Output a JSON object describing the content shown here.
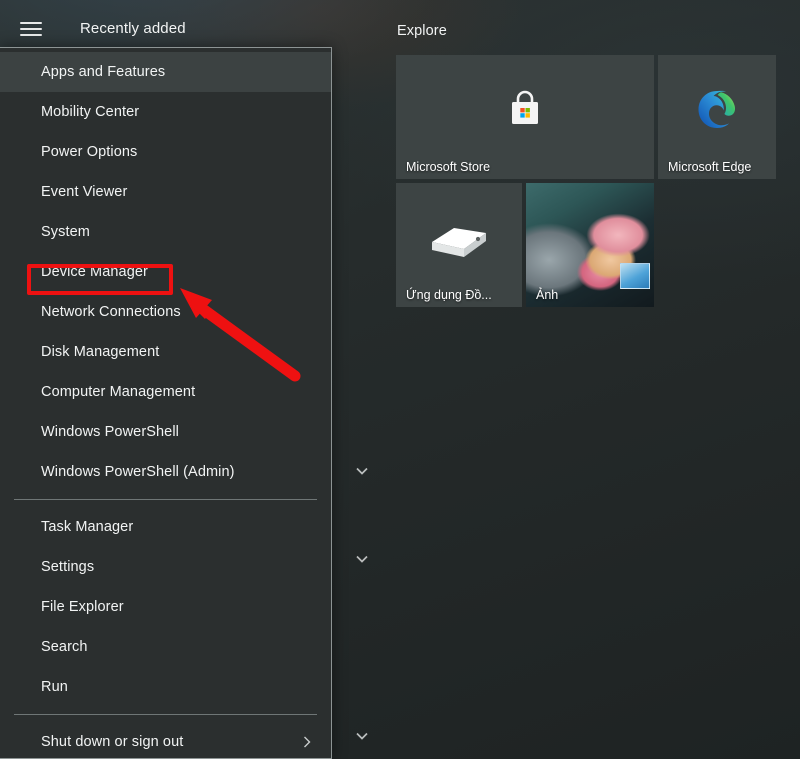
{
  "header": {
    "hamburger_icon": "hamburger-menu-icon",
    "recently_added_label": "Recently added",
    "explore_label": "Explore"
  },
  "tiles": [
    {
      "label": "Microsoft Store",
      "icon": "microsoft-store-icon"
    },
    {
      "label": "Microsoft Edge",
      "icon": "microsoft-edge-icon"
    },
    {
      "label": "Ứng dụng Đồ...",
      "icon": "three-d-viewer-icon"
    },
    {
      "label": "Ảnh",
      "icon": "photos-thumbnail"
    }
  ],
  "group_chevrons": {
    "icon": "chevron-down-icon",
    "count": 3
  },
  "winx_menu": {
    "items": [
      {
        "label": "Apps and Features",
        "highlighted": true
      },
      {
        "label": "Mobility Center",
        "highlighted": false
      },
      {
        "label": "Power Options",
        "highlighted": false
      },
      {
        "label": "Event Viewer",
        "highlighted": false
      },
      {
        "label": "System",
        "highlighted": false
      },
      {
        "label": "Device Manager",
        "highlighted": false
      },
      {
        "label": "Network Connections",
        "highlighted": false
      },
      {
        "label": "Disk Management",
        "highlighted": false
      },
      {
        "label": "Computer Management",
        "highlighted": false
      },
      {
        "label": "Windows PowerShell",
        "highlighted": false
      },
      {
        "label": "Windows PowerShell (Admin)",
        "highlighted": false
      }
    ],
    "group_two": [
      {
        "label": "Task Manager"
      },
      {
        "label": "Settings"
      },
      {
        "label": "File Explorer"
      },
      {
        "label": "Search"
      },
      {
        "label": "Run"
      }
    ],
    "group_three": [
      {
        "label": "Shut down or sign out",
        "submenu_icon": "chevron-right-icon"
      }
    ]
  },
  "annotation": {
    "highlight_target": "Device Manager",
    "box_color": "#ee1111",
    "arrow_color": "#ee1111",
    "arrow_icon": "pointer-arrow-icon"
  },
  "colors": {
    "menu_background": "#2b2f2f",
    "menu_border": "#8d9494",
    "menu_highlight": "#3c4242",
    "tile_background": "#3d4444",
    "text": "#f2f4f4",
    "accent_red": "#ee1111"
  }
}
